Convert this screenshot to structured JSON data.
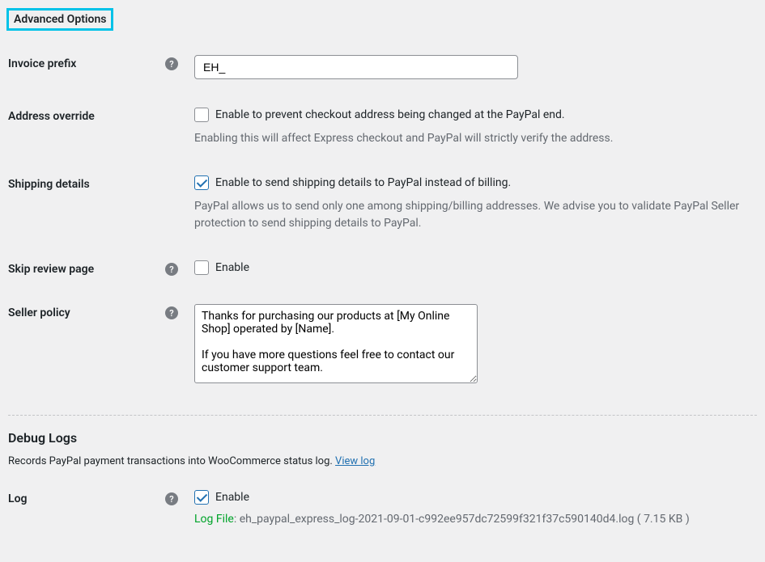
{
  "advanced": {
    "title": "Advanced Options",
    "invoicePrefix": {
      "label": "Invoice prefix",
      "value": "EH_"
    },
    "addressOverride": {
      "label": "Address override",
      "checkbox": "Enable to prevent checkout address being changed at the PayPal end.",
      "description": "Enabling this will affect Express checkout and PayPal will strictly verify the address."
    },
    "shippingDetails": {
      "label": "Shipping details",
      "checkbox": "Enable to send shipping details to PayPal instead of billing.",
      "description": "PayPal allows us to send only one among shipping/billing addresses. We advise you to validate PayPal Seller protection to send shipping details to PayPal."
    },
    "skipReview": {
      "label": "Skip review page",
      "checkbox": "Enable"
    },
    "sellerPolicy": {
      "label": "Seller policy",
      "value": "Thanks for purchasing our products at [My Online Shop] operated by [Name].\n\nIf you have more questions feel free to contact our customer support team."
    }
  },
  "debug": {
    "heading": "Debug Logs",
    "descriptionPrefix": "Records PayPal payment transactions into WooCommerce status log. ",
    "viewLogLink": "View log",
    "log": {
      "label": "Log",
      "checkbox": "Enable",
      "fileLabel": "Log File",
      "fileName": ": eh_paypal_express_log-2021-09-01-c992ee957dc72599f321f37c590140d4.log ( 7.15 KB )"
    }
  }
}
